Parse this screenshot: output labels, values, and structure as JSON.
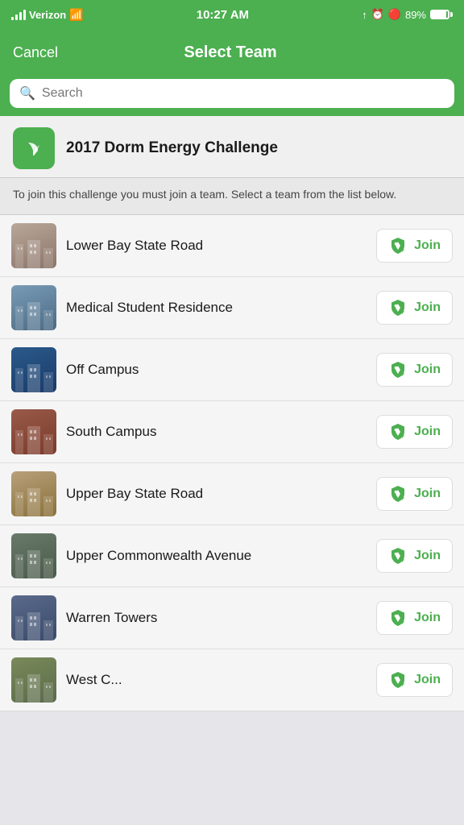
{
  "statusBar": {
    "carrier": "Verizon",
    "time": "10:27 AM",
    "battery": "89%"
  },
  "navBar": {
    "cancelLabel": "Cancel",
    "title": "Select Team"
  },
  "search": {
    "placeholder": "Search"
  },
  "challenge": {
    "title": "2017 Dorm Energy Challenge",
    "description": "To join this challenge you must join a team. Select a team from the list below."
  },
  "teams": [
    {
      "id": "lower-bay",
      "name": "Lower Bay State Road",
      "photoClass": "photo-lower-bay"
    },
    {
      "id": "medical",
      "name": "Medical Student Residence",
      "photoClass": "photo-medical"
    },
    {
      "id": "off-campus",
      "name": "Off Campus",
      "photoClass": "photo-off-campus"
    },
    {
      "id": "south-campus",
      "name": "South Campus",
      "photoClass": "photo-south-campus"
    },
    {
      "id": "upper-bay",
      "name": "Upper Bay State Road",
      "photoClass": "photo-upper-bay"
    },
    {
      "id": "upper-commonwealth",
      "name": "Upper Commonwealth Avenue",
      "photoClass": "photo-upper-commonwealth"
    },
    {
      "id": "warren",
      "name": "Warren Towers",
      "photoClass": "photo-warren"
    },
    {
      "id": "west",
      "name": "West C...",
      "photoClass": "photo-west"
    }
  ],
  "joinButton": {
    "label": "Join"
  }
}
